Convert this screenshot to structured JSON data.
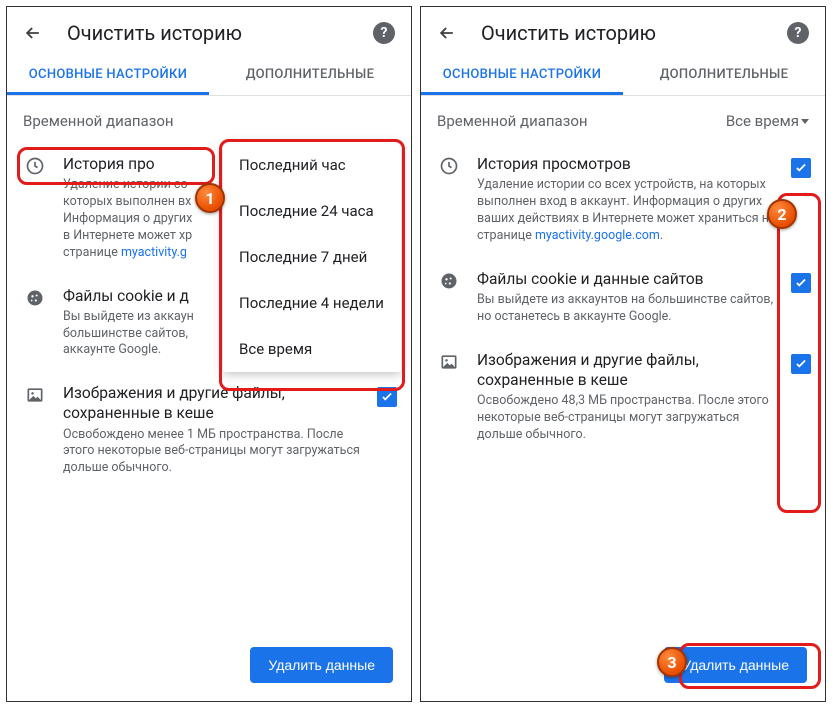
{
  "header": {
    "title": "Очистить историю"
  },
  "tabs": {
    "basic": "ОСНОВНЫЕ НАСТРОЙКИ",
    "advanced": "ДОПОЛНИТЕЛЬНЫЕ"
  },
  "range": {
    "label": "Временной диапазон",
    "selected": "Все время",
    "options": [
      "Последний час",
      "Последние 24 часа",
      "Последние 7 дней",
      "Последние 4 недели",
      "Все время"
    ]
  },
  "left": {
    "history": {
      "title": "История про",
      "desc1": "Удаление истории со",
      "desc2": "которых выполнен вх",
      "desc3": "Информация о других",
      "desc4": "в Интернете может хр",
      "desc5_prefix": "странице ",
      "link": "myactivity.g"
    },
    "cookies": {
      "title": "Файлы cookie и д",
      "desc1": "Вы выйдете из аккаун",
      "desc2": "большинстве сайтов,",
      "desc3": "аккаунте Google."
    },
    "cache": {
      "title": "Изображения и другие файлы, сохраненные в кеше",
      "desc": "Освобождено менее 1 МБ пространства. После этого некоторые веб-страницы могут загружаться дольше обычного."
    }
  },
  "right": {
    "history": {
      "title": "История просмотров",
      "desc_prefix": "Удаление истории со всех устройств, на которых выполнен вход в аккаунт. Информация о других ваших действиях в Интернете может храниться на странице ",
      "link": "myactivity.google.com",
      "desc_suffix": "."
    },
    "cookies": {
      "title": "Файлы cookie и данные сайтов",
      "desc": "Вы выйдете из аккаунтов на большинстве сайтов, но останетесь в аккаунте Google."
    },
    "cache": {
      "title": "Изображения и другие файлы, сохраненные в кеше",
      "desc": "Освобождено 48,3 МБ пространства. После этого некоторые веб-страницы могут загружаться дольше обычного."
    }
  },
  "delete_button": "Удалить данные",
  "badges": {
    "one": "1",
    "two": "2",
    "three": "3"
  }
}
